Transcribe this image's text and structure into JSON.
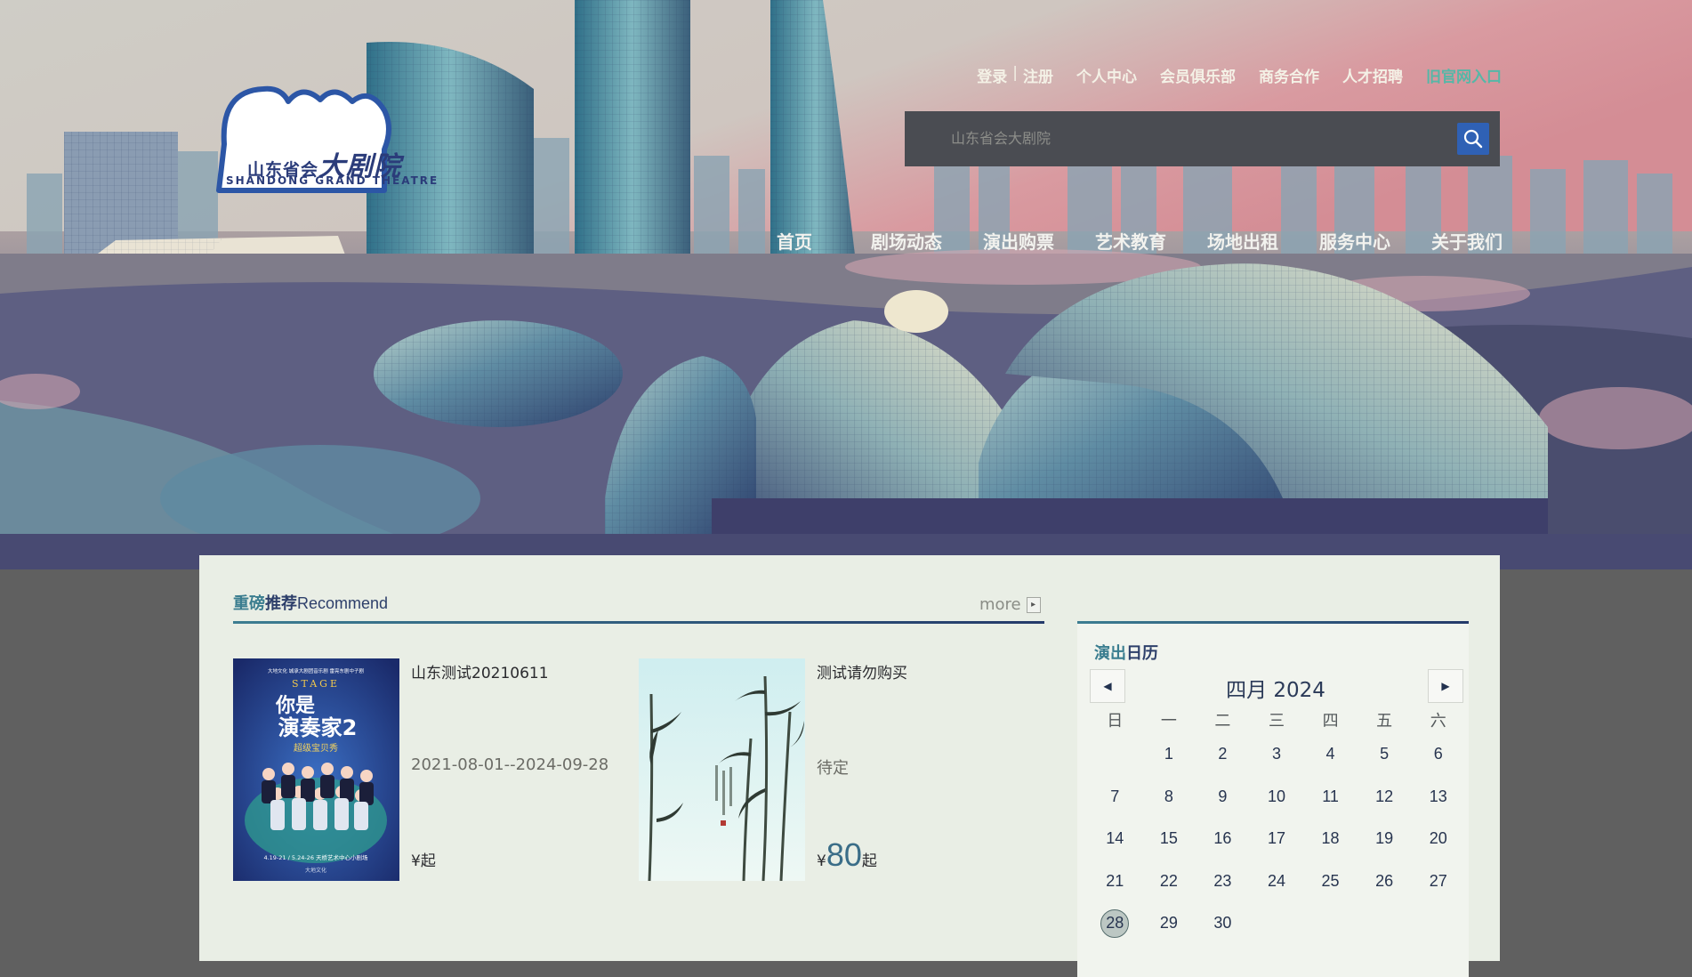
{
  "header": {
    "logo": {
      "cn": "山东省会",
      "cn_big": "大剧院",
      "en": "SHANDONG GRAND THEATRE"
    },
    "top_links": {
      "login": "登录",
      "separator": "|",
      "register": "注册",
      "personal_center": "个人中心",
      "member_club": "会员俱乐部",
      "business": "商务合作",
      "recruitment": "人才招聘",
      "old_site": "旧官网入口"
    },
    "search": {
      "placeholder": "山东省会大剧院"
    },
    "nav": [
      "首页",
      "剧场动态",
      "演出购票",
      "艺术教育",
      "场地出租",
      "服务中心",
      "关于我们"
    ]
  },
  "recommend": {
    "title_highlight": "重磅",
    "title_dark": "推荐",
    "title_en": "Recommend",
    "more_label": "more",
    "items": [
      {
        "name": "山东测试20210611",
        "date": "2021-08-01--2024-09-28",
        "currency": "¥",
        "price": "",
        "suffix": "起",
        "poster": {
          "top_line": "大地文化  城承大剧团音乐剧  雷亮东剧中子剧",
          "art_letters": "STAGE",
          "title_1": "你是",
          "title_2": "演奏家2",
          "subtitle": "超级宝贝秀",
          "dates": "4.19-21 / 5.24-26  天桥艺术中心小剧场",
          "footer": "大地文化"
        }
      },
      {
        "name": "测试请勿购买",
        "date": "待定",
        "currency": "¥",
        "price": "80",
        "suffix": "起"
      }
    ]
  },
  "calendar": {
    "title_highlight": "演出",
    "title_dark": "日历",
    "month_label": "四月 2024",
    "weekdays": [
      "日",
      "一",
      "二",
      "三",
      "四",
      "五",
      "六"
    ],
    "leading_blank_days": 1,
    "days_in_month": 30,
    "today": 28
  },
  "colors": {
    "accent_teal": "#3a7d8f",
    "accent_navy": "#2d3f6a",
    "search_button": "#2f61b5",
    "old_site_link": "#55b7a7"
  }
}
